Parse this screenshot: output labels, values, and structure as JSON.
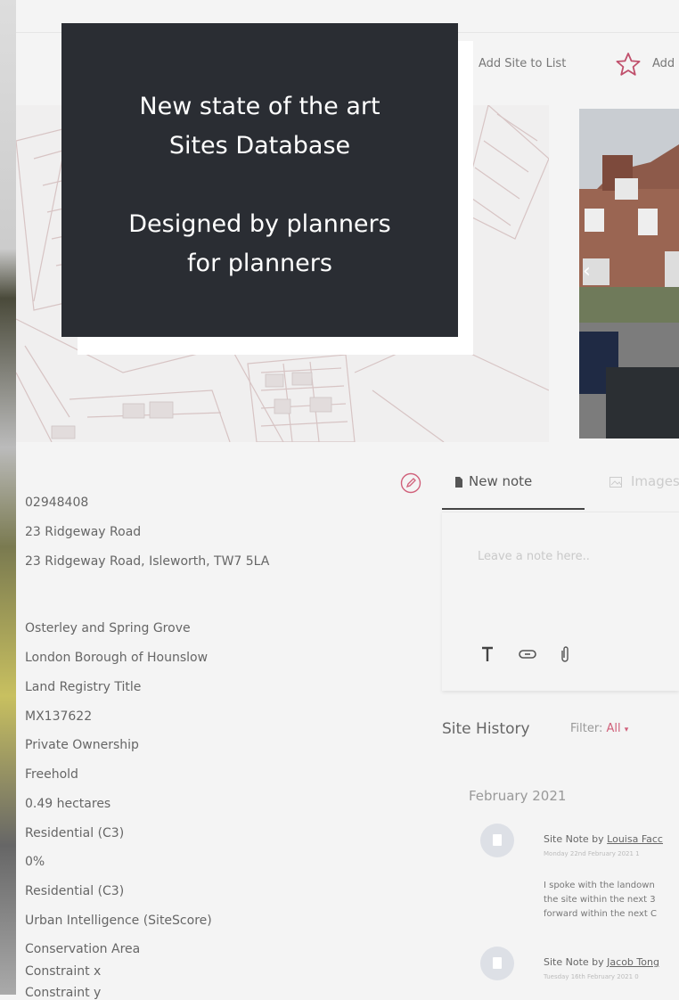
{
  "overlay": {
    "line1": "New state of the art",
    "line2": "Sites Database",
    "line3": "Designed by planners",
    "line4": "for planners"
  },
  "toolbar": {
    "add_site_label": "Add Site to List",
    "add_favourite_label": "Add"
  },
  "site_details": [
    "02948408",
    "23 Ridgeway Road",
    "23 Ridgeway Road, Isleworth, TW7 5LA",
    "Osterley and Spring Grove",
    "London Borough of Hounslow",
    "Land Registry Title",
    "MX137622",
    "Private Ownership",
    "Freehold",
    "0.49 hectares",
    "Residential (C3)",
    "0%",
    "Residential (C3)",
    "Urban Intelligence (SiteScore)",
    "Conservation Area",
    "Constraint x",
    "Constraint y"
  ],
  "note_tabs": {
    "new_note": "New note",
    "images": "Images"
  },
  "note_editor": {
    "placeholder": "Leave a note here.."
  },
  "history": {
    "title": "Site History",
    "filter_label": "Filter:",
    "filter_value": "All",
    "month": "February 2021",
    "entries": [
      {
        "title_prefix": "Site Note by",
        "author": "Louisa Facc",
        "date": "Monday 22nd February 2021 1",
        "body_lines": [
          "I spoke with the landown",
          "the site within the next 3",
          "forward within the next C"
        ]
      },
      {
        "title_prefix": "Site Note by",
        "author": "Jacob Tong",
        "date": "Tuesday 16th February 2021 0"
      }
    ]
  },
  "colors": {
    "overlay_bg": "#2a2d33",
    "accent": "#d0607a",
    "page_bg": "#f4f4f4"
  }
}
